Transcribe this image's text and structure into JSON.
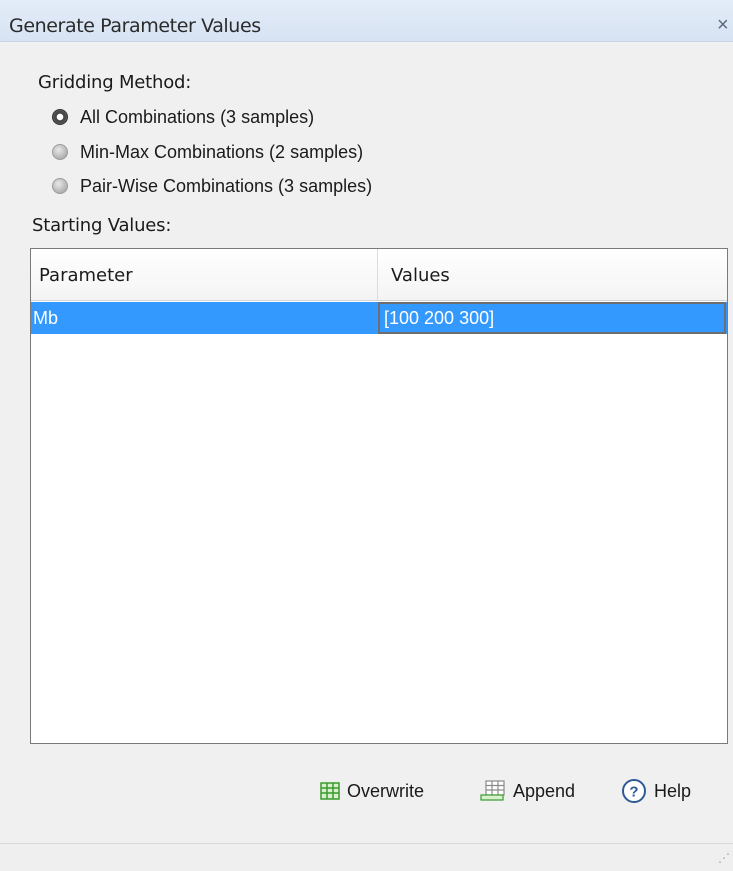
{
  "window": {
    "title": "Generate Parameter Values",
    "close_glyph": "×"
  },
  "gridding": {
    "label": "Gridding Method:",
    "options": [
      {
        "label": "All Combinations (3 samples)",
        "selected": true
      },
      {
        "label": "Min-Max Combinations (2 samples)",
        "selected": false
      },
      {
        "label": "Pair-Wise Combinations (3 samples)",
        "selected": false
      }
    ]
  },
  "starting_values": {
    "label": "Starting Values:",
    "columns": [
      "Parameter",
      "Values"
    ],
    "rows": [
      {
        "parameter": "Mb",
        "values": "[100 200 300]",
        "selected": true
      }
    ]
  },
  "buttons": {
    "overwrite": {
      "label": "Overwrite",
      "icon": "table-overwrite-icon"
    },
    "append": {
      "label": "Append",
      "icon": "table-append-icon"
    },
    "help": {
      "label": "Help",
      "icon": "help-icon"
    }
  },
  "colors": {
    "selection": "#3399ff",
    "icon_green": "#3a9a2e"
  },
  "status": {
    "grip_glyph": "⋰"
  }
}
